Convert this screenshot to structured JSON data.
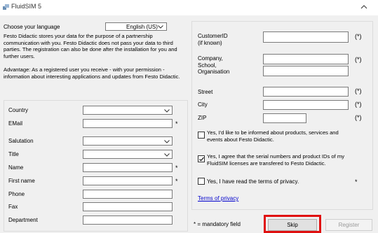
{
  "window": {
    "title": "FluidSIM 5"
  },
  "language": {
    "label": "Choose your language",
    "selected": "English (US)"
  },
  "info": {
    "text1": "Festo Didactic stores your data for the purpose of a partnership communication with you. Festo Didactic does not pass your data to third parties. The registration can also be done after the installation for you and further users.",
    "text2": "Advantage: As a registered user you receive - with your permission - information about interesting applications and updates from Festo Didactic."
  },
  "left_form": {
    "country": "Country",
    "email": "EMail",
    "salutation": "Salutation",
    "title": "Title",
    "name": "Name",
    "first_name": "First name",
    "phone": "Phone",
    "fax": "Fax",
    "department": "Department",
    "required_mark": "*"
  },
  "right_form": {
    "customer_id": "CustomerID\n(if known)",
    "company": "Company,\nSchool,\nOrganisation",
    "street": "Street",
    "city": "City",
    "zip": "ZIP",
    "optional_mark": "(*)"
  },
  "checkboxes": [
    {
      "label": "Yes, I'd like to be informed about products, services and events about Festo Didactic.",
      "checked": false
    },
    {
      "label": "Yes, I agree that the serial numbers and product IDs of my FluidSIM licenses are transfered to Festo Didactic.",
      "checked": true
    },
    {
      "label": "Yes, I have read the terms of privacy.",
      "checked": false,
      "mark": "*"
    }
  ],
  "privacy_link": "Terms of privacy",
  "mandatory_note": "* = mandatory field",
  "buttons": {
    "skip": "Skip",
    "register": "Register"
  }
}
